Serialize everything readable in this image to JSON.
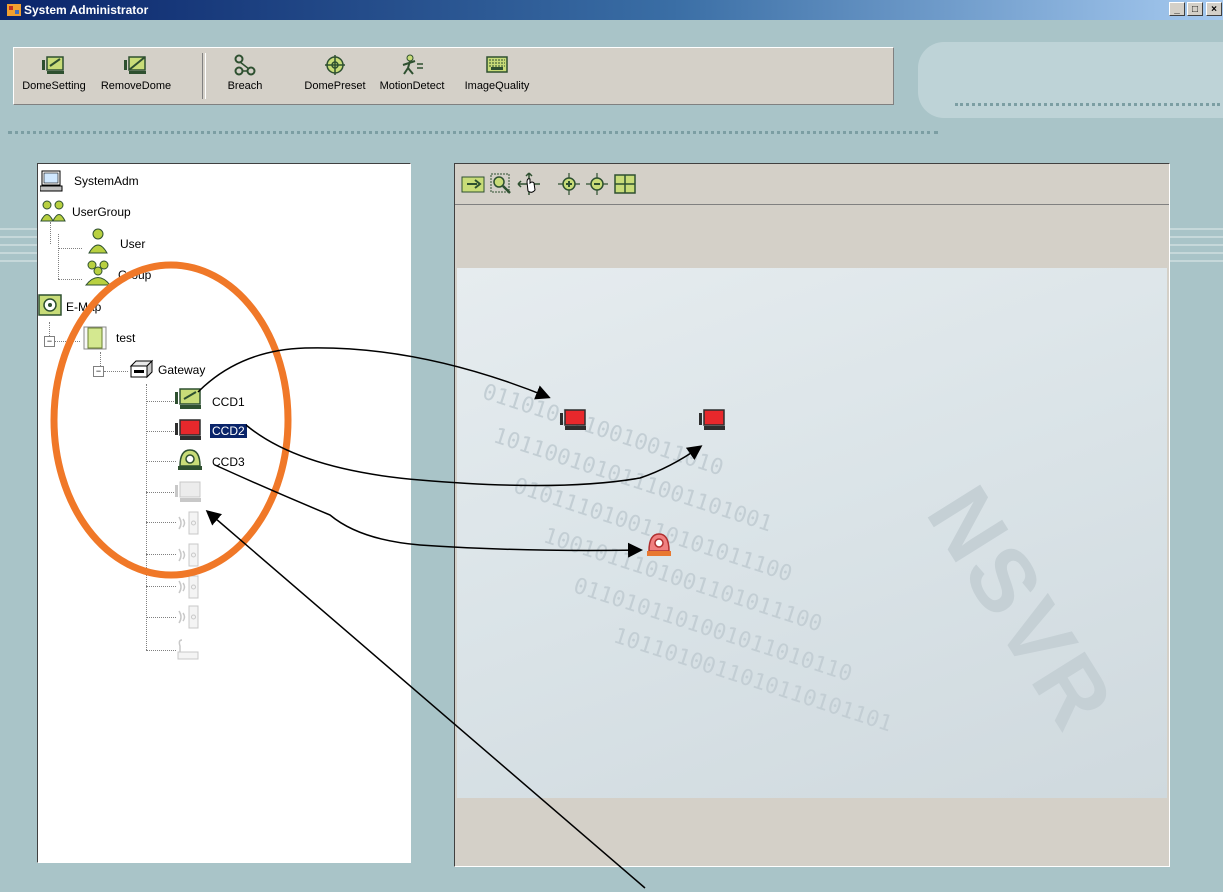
{
  "window": {
    "title": "System Administrator",
    "controls": {
      "minimize": "_",
      "maximize": "□",
      "close": "×"
    }
  },
  "toolbar": {
    "buttons": [
      {
        "label": "DomeSetting",
        "icon": "dome-setting-icon"
      },
      {
        "label": "RemoveDome",
        "icon": "remove-dome-icon"
      },
      {
        "label": "Breach",
        "icon": "breach-icon"
      },
      {
        "label": "DomePreset",
        "icon": "dome-preset-icon"
      },
      {
        "label": "MotionDetect",
        "icon": "motion-detect-icon"
      },
      {
        "label": "ImageQuality",
        "icon": "image-quality-icon"
      }
    ]
  },
  "tree": {
    "system_adm": "SystemAdm",
    "user_group": "UserGroup",
    "user": "User",
    "group": "Group",
    "emap": "E-Map",
    "test": "test",
    "gateway": "Gateway",
    "ccd1": "CCD1",
    "ccd2": "CCD2",
    "ccd3": "CCD3",
    "expander_collapse": "−"
  },
  "map": {
    "tools": [
      "select-tool-icon",
      "zoom-area-icon",
      "pan-icon",
      "zoom-in-icon",
      "zoom-out-icon",
      "fit-window-icon"
    ],
    "watermark": "NSVR",
    "devices": [
      "CCD1",
      "CCD2",
      "CCD3"
    ]
  },
  "colors": {
    "title_bar": "#0a246a",
    "annotation_circle": "#f07828",
    "selected_bg": "#0a246a",
    "camera_red": "#e8282c",
    "camera_green": "#b8d040"
  }
}
